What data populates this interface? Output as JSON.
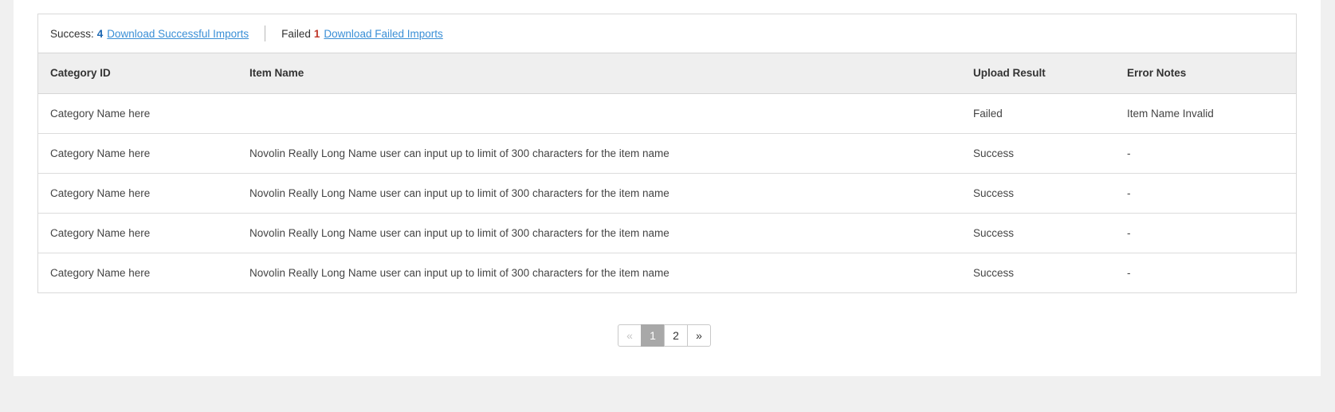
{
  "summary": {
    "success_label": "Success:",
    "success_count": "4",
    "success_link": "Download Successful Imports",
    "failed_label": "Failed",
    "failed_count": "1",
    "failed_link": "Download Failed Imports"
  },
  "table": {
    "headers": [
      "Category ID",
      "Item Name",
      "Upload Result",
      "Error Notes"
    ],
    "rows": [
      [
        "Category Name here",
        "",
        "Failed",
        "Item Name Invalid"
      ],
      [
        "Category Name here",
        "Novolin Really Long Name user can input up to limit of 300 characters for the item name",
        "Success",
        "-"
      ],
      [
        "Category Name here",
        "Novolin Really Long Name user can input up to limit of 300 characters for the item name",
        "Success",
        "-"
      ],
      [
        "Category Name here",
        "Novolin Really Long Name user can input up to limit of 300 characters for the item name",
        "Success",
        "-"
      ],
      [
        "Category Name here",
        "Novolin Really Long Name user can input up to limit of 300 characters for the item name",
        "Success",
        "-"
      ]
    ]
  },
  "pagination": {
    "prev": "«",
    "pages": [
      "1",
      "2"
    ],
    "current": "1",
    "next": "»"
  },
  "colors": {
    "success_count": "#1b66b1",
    "failed_count": "#c0392b",
    "link": "#3a8fd6",
    "active_page": "#a8a8a8"
  }
}
